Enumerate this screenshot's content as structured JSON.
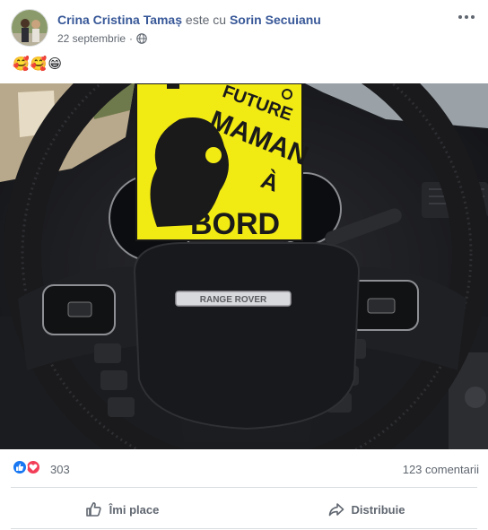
{
  "post": {
    "author": "Crina Cristina Tamaș",
    "with_text": "este cu",
    "tagged": "Sorin Secuianu",
    "date": "22 septembrie",
    "emojis": "🥰🥰😁",
    "photo": {
      "sign_lines": [
        "FUTURE",
        "MAMAN",
        "À",
        "BORD"
      ],
      "badge_text": "RANGE ROVER"
    }
  },
  "engagement": {
    "reactions_count": "303",
    "comments": "123 comentarii"
  },
  "actions": {
    "like": "Îmi place",
    "share": "Distribuie"
  },
  "icons": {
    "audience": "globe-icon",
    "more": "more-options-icon",
    "like_reaction": "like-reaction-icon",
    "love_reaction": "love-reaction-icon",
    "like_action": "thumbs-up-icon",
    "share_action": "share-arrow-icon"
  },
  "colors": {
    "link": "#385898",
    "like_blue": "#1877f2",
    "love_red": "#f33e58",
    "sign_yellow": "#f2ea13"
  }
}
